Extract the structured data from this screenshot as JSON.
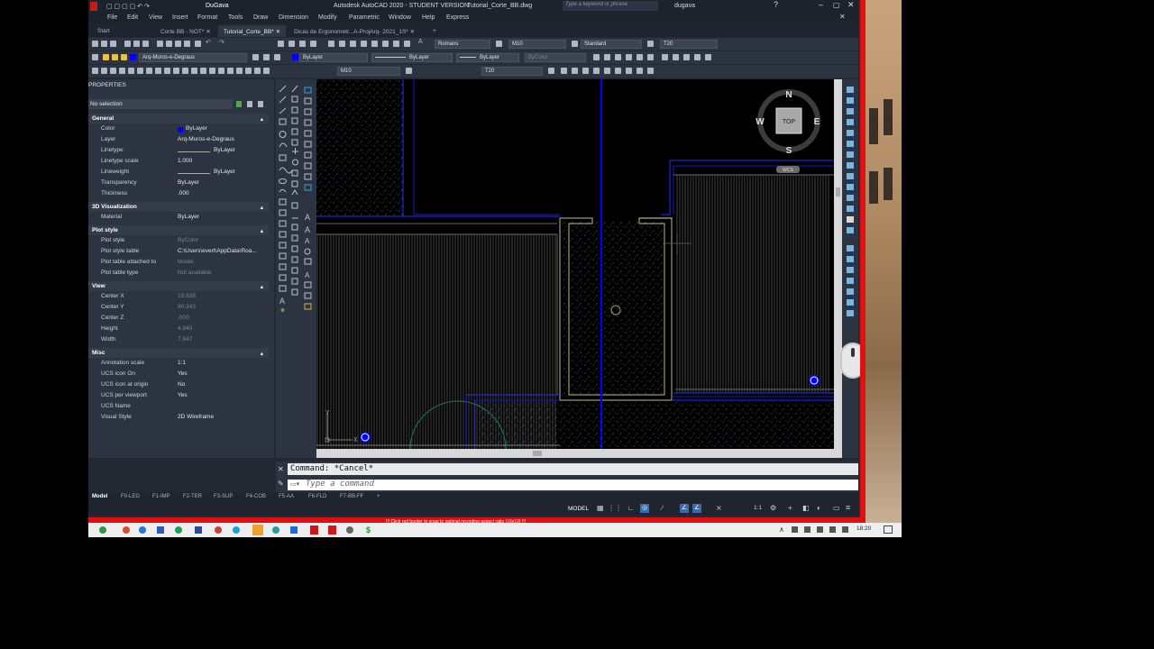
{
  "titlebar": {
    "workspace": "DuGava",
    "title": "Autodesk AutoCAD 2020 - STUDENT VERSION",
    "filename": "Tutorial_Corte_BB.dwg",
    "search_placeholder": "Type a keyword or phrase",
    "user": "dugava"
  },
  "menu": [
    "File",
    "Edit",
    "View",
    "Insert",
    "Format",
    "Tools",
    "Draw",
    "Dimension",
    "Modify",
    "Parametric",
    "Window",
    "Help",
    "Express"
  ],
  "tabs": [
    {
      "label": "Start"
    },
    {
      "label": "Corte BB - NOT*"
    },
    {
      "label": "Tutorial_Corte_BB*"
    },
    {
      "label": "Dicas de Ergonometr...A-ProjArq- 2021_1S*"
    }
  ],
  "toolbar": {
    "text_style": "Romans",
    "dim_style": "M10",
    "table_style": "Standard",
    "mleader_style": "T20",
    "layer": "Arq-Muros-e-Degraus",
    "color": "ByLayer",
    "linetype": "ByLayer",
    "lineweight": "ByLayer",
    "plotstyle": "ByColor",
    "scale_dim": "M10",
    "scale_text": "T20"
  },
  "properties": {
    "header": "PROPERTIES",
    "selection": "No selection",
    "sections": {
      "general": "General",
      "visualization": "3D Visualization",
      "plot": "Plot style",
      "view": "View",
      "misc": "Misc"
    },
    "general": [
      {
        "k": "Color",
        "v": "ByLayer"
      },
      {
        "k": "Layer",
        "v": "Arq-Muros-e-Degraus"
      },
      {
        "k": "Linetype",
        "v": "ByLayer"
      },
      {
        "k": "Linetype scale",
        "v": "1.000"
      },
      {
        "k": "Lineweight",
        "v": "ByLayer"
      },
      {
        "k": "Transparency",
        "v": "ByLayer"
      },
      {
        "k": "Thickness",
        "v": ".000"
      }
    ],
    "visualization": [
      {
        "k": "Material",
        "v": "ByLayer"
      }
    ],
    "plot": [
      {
        "k": "Plot style",
        "v": "ByColor"
      },
      {
        "k": "Plot style table",
        "v": "C:\\Users\\evert\\AppData\\Roa..."
      },
      {
        "k": "Plot table attached to",
        "v": "Model"
      },
      {
        "k": "Plot table type",
        "v": "Not available"
      }
    ],
    "view": [
      {
        "k": "Center X",
        "v": "19.838"
      },
      {
        "k": "Center Y",
        "v": "90.343"
      },
      {
        "k": "Center Z",
        "v": ".000"
      },
      {
        "k": "Height",
        "v": "4.940"
      },
      {
        "k": "Width",
        "v": "7.847"
      }
    ],
    "misc": [
      {
        "k": "Annotation scale",
        "v": "1:1"
      },
      {
        "k": "UCS icon On",
        "v": "Yes"
      },
      {
        "k": "UCS icon at origin",
        "v": "No"
      },
      {
        "k": "UCS per viewport",
        "v": "Yes"
      },
      {
        "k": "UCS Name",
        "v": ""
      },
      {
        "k": "Visual Style",
        "v": "2D Wireframe"
      }
    ]
  },
  "viewcube": {
    "n": "N",
    "s": "S",
    "e": "E",
    "w": "W",
    "face": "TOP",
    "wcs": "WCS"
  },
  "ucs": {
    "y": "Y",
    "x": "X"
  },
  "command": {
    "history": "Command: *Cancel*",
    "placeholder": "Type a command"
  },
  "layouts": [
    "Model",
    "F0-LEG",
    "F1-IMP",
    "F2-TER",
    "F3-SUP",
    "F4-COB",
    "F5-AA",
    "F6-FLD",
    "F7-BB-FF"
  ],
  "statusbar": {
    "mode": "MODEL",
    "scale": "1:1"
  },
  "recording_notice": "!!! Click red border to snap to optimal recording aspect ratio (16x10) !!!",
  "taskbar": {
    "time": "18:20"
  },
  "colors": {
    "accent": "#0000ff",
    "red": "#e01010",
    "wall": "#9a9a70"
  }
}
